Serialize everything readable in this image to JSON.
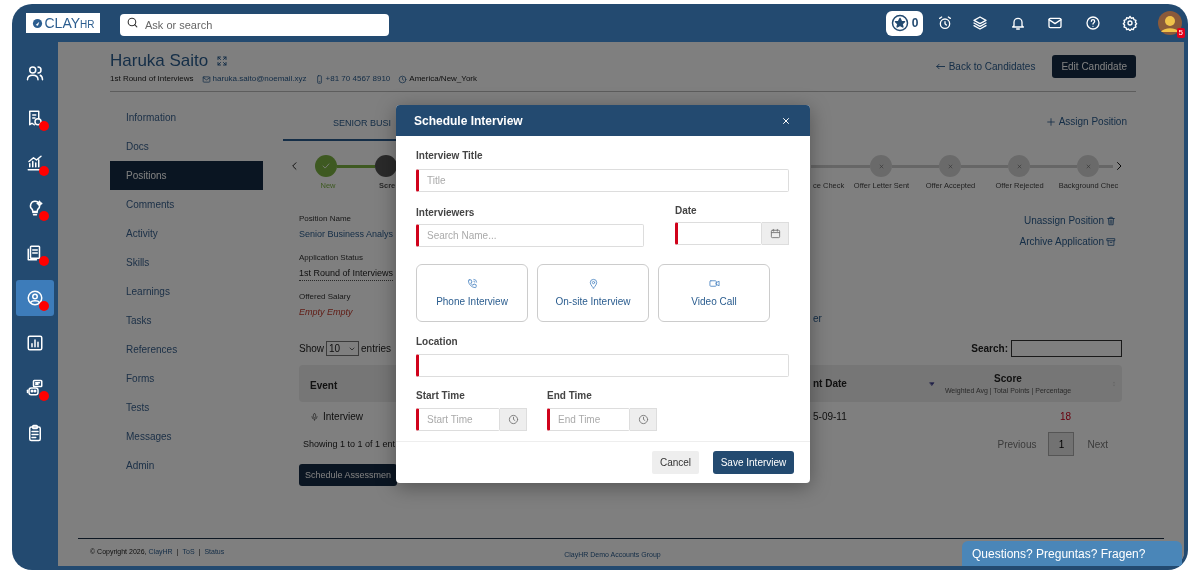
{
  "topbar": {
    "logo": {
      "text": "CLAY",
      "suffix": "HR"
    },
    "search": {
      "placeholder": "Ask or search"
    },
    "points": "0",
    "avatar": {
      "badge": "5"
    }
  },
  "sidebar": {
    "items": [
      {
        "selected": false,
        "alert": false
      },
      {
        "selected": false,
        "alert": true
      },
      {
        "selected": false,
        "alert": true
      },
      {
        "selected": false,
        "alert": true
      },
      {
        "selected": false,
        "alert": true
      },
      {
        "selected": true,
        "alert": true
      },
      {
        "selected": false,
        "alert": false
      },
      {
        "selected": false,
        "alert": true
      },
      {
        "selected": false,
        "alert": false
      }
    ]
  },
  "candidate": {
    "name": "Haruka Saito",
    "status": "1st Round of Interviews",
    "email": "haruka.saito@noemail.xyz",
    "phone": "+81 70 4567 8910",
    "timezone": "America/New_York"
  },
  "actions": {
    "back": "Back to Candidates",
    "edit": "Edit Candidate"
  },
  "nav": [
    {
      "label": "Information",
      "selected": false
    },
    {
      "label": "Docs",
      "selected": false
    },
    {
      "label": "Positions",
      "selected": true
    },
    {
      "label": "Comments",
      "selected": false
    },
    {
      "label": "Activity",
      "selected": false
    },
    {
      "label": "Skills",
      "selected": false
    },
    {
      "label": "Learnings",
      "selected": false
    },
    {
      "label": "Tasks",
      "selected": false
    },
    {
      "label": "References",
      "selected": false
    },
    {
      "label": "Forms",
      "selected": false
    },
    {
      "label": "Tests",
      "selected": false
    },
    {
      "label": "Messages",
      "selected": false
    },
    {
      "label": "Admin",
      "selected": false
    }
  ],
  "position_tab": {
    "label": "SENIOR BUSI",
    "selected": true
  },
  "assign_position": "Assign Position",
  "stages": {
    "left": [
      {
        "label": "New",
        "done": true,
        "current": false
      },
      {
        "label": "Scre",
        "done": false,
        "current": true
      }
    ],
    "right": [
      {
        "label": "ce Check",
        "done": false,
        "current": false
      },
      {
        "label": "Offer Letter Sent",
        "done": false,
        "current": false
      },
      {
        "label": "Offer Accepted",
        "done": false,
        "current": false
      },
      {
        "label": "Offer Rejected",
        "done": false,
        "current": false
      },
      {
        "label": "Background Chec",
        "done": false,
        "current": false
      }
    ]
  },
  "details": {
    "fields": [
      {
        "label": "Position Name",
        "value": "Senior Business Analys",
        "kind": "link"
      },
      {
        "label": "Application Status",
        "value": "1st Round of Interviews",
        "kind": "status"
      },
      {
        "label": "Offered Salary",
        "value": "Empty Empty",
        "kind": "empty"
      }
    ],
    "column_3": "er",
    "links": [
      {
        "label": "Unassign Position",
        "kind": "trash"
      },
      {
        "label": "Archive Application",
        "kind": "archive"
      }
    ]
  },
  "table": {
    "show_label": "Show",
    "page_size": "10",
    "entries_label": "entries",
    "search_label": "Search:",
    "columns": [
      {
        "label": "Event"
      },
      {
        "label": "nt Date"
      },
      {
        "label": "Score",
        "sublabel": "Weighted Avg | Total Points | Percentage"
      }
    ],
    "rows": [
      {
        "event": "Interview",
        "date": "5-09-11",
        "score": "18"
      }
    ],
    "info": "Showing 1 to 1 of 1 ent",
    "pagination": {
      "previous": "Previous",
      "pages": [
        {
          "label": "1",
          "selected": true
        }
      ],
      "next": "Next"
    }
  },
  "schedule_button": "Schedule Assessmen",
  "footer": {
    "copyright": "© Copyright 2026,",
    "links": [
      "ClayHR",
      "ToS",
      "Status"
    ],
    "separator": "|",
    "center": "ClayHR Demo Accounts Group"
  },
  "help_tab": "Questions? Preguntas? Fragen?",
  "modal": {
    "title": "Schedule Interview",
    "interview_title": {
      "label": "Interview Title",
      "placeholder": "Title",
      "required": true
    },
    "interviewers": {
      "label": "Interviewers",
      "placeholder": "Search Name...",
      "required": true
    },
    "date": {
      "label": "Date",
      "required": true
    },
    "types": [
      {
        "label": "Phone Interview",
        "selected": false
      },
      {
        "label": "On-site Interview",
        "selected": false
      },
      {
        "label": "Video Call",
        "selected": false
      }
    ],
    "location": {
      "label": "Location",
      "required": true
    },
    "start_time": {
      "label": "Start Time",
      "placeholder": "Start Time",
      "required": true
    },
    "end_time": {
      "label": "End Time",
      "placeholder": "End Time",
      "required": true
    },
    "buttons": {
      "cancel": "Cancel",
      "save": "Save Interview"
    }
  }
}
